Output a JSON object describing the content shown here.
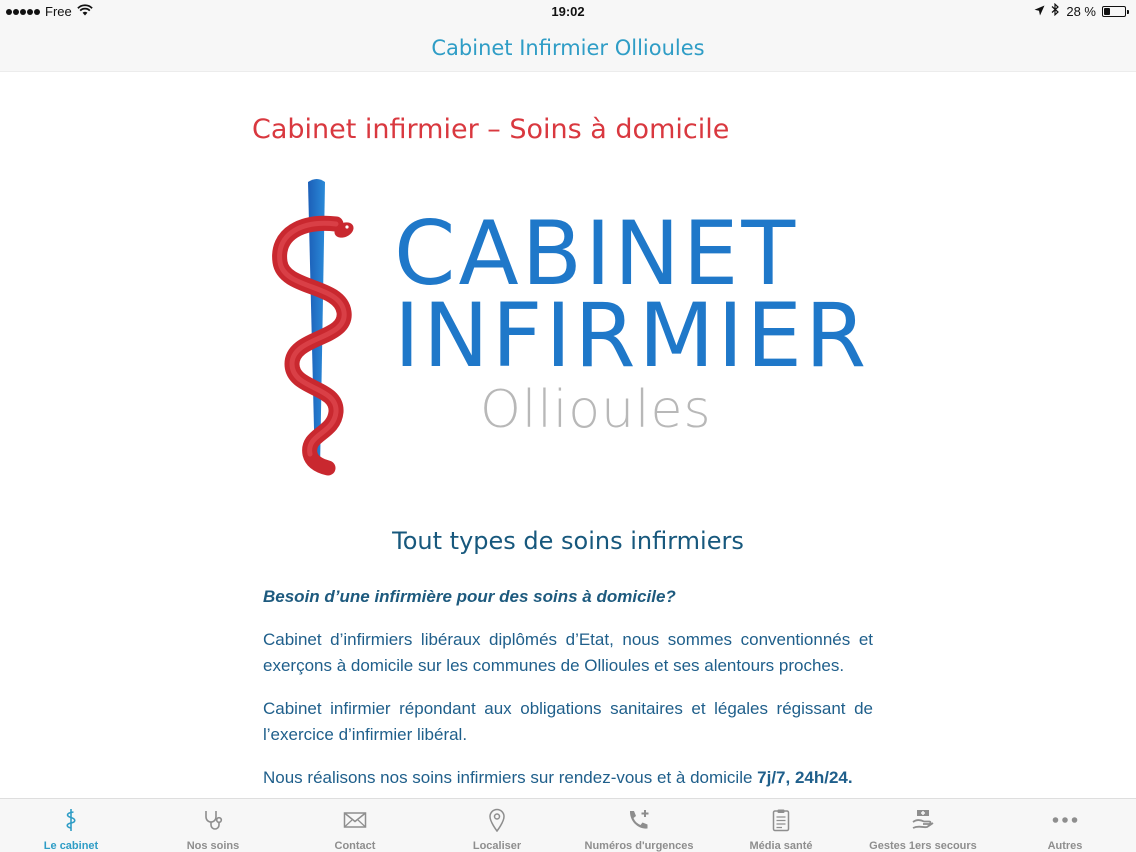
{
  "status": {
    "carrier": "Free",
    "time": "19:02",
    "battery": "28 %",
    "battery_level": 0.28
  },
  "nav": {
    "title": "Cabinet Infirmier Ollioules"
  },
  "page": {
    "heading": "Cabinet infirmier – Soins à domicile",
    "logo": {
      "word1": "CABINET",
      "word2": "INFIRMIER",
      "word3": "Ollioules",
      "colors": {
        "snake": "#d9383f",
        "staff": "#1f78c9",
        "wordmark": "#1f78c9",
        "subtitle": "#b8b8b8"
      }
    },
    "section_title": "Tout types de soins infirmiers",
    "lead": "Besoin d’une infirmière pour des soins à domicile?",
    "paragraphs": [
      "Cabinet d’infirmiers libéraux diplômés d’Etat, nous sommes conventionnés et exerçons à domicile sur les communes de Ollioules et ses alentours proches.",
      "Cabinet infirmier répondant aux obligations sanitaires et légales régissant de l’exercice d’infirmier libéral."
    ],
    "last_paragraph": {
      "text": "Nous réalisons nos soins infirmiers sur rendez-vous et à domicile ",
      "emphasis": "7j/7, 24h/24."
    }
  },
  "tabs": [
    {
      "label": "Le cabinet",
      "icon": "caduceus-icon",
      "active": true
    },
    {
      "label": "Nos soins",
      "icon": "stethoscope-icon",
      "active": false
    },
    {
      "label": "Contact",
      "icon": "envelope-icon",
      "active": false
    },
    {
      "label": "Localiser",
      "icon": "map-pin-icon",
      "active": false
    },
    {
      "label": "Numéros d'urgences",
      "icon": "phone-plus-icon",
      "active": false
    },
    {
      "label": "Média santé",
      "icon": "clipboard-icon",
      "active": false
    },
    {
      "label": "Gestes 1ers secours",
      "icon": "first-aid-hand-icon",
      "active": false
    },
    {
      "label": "Autres",
      "icon": "more-dots-icon",
      "active": false
    }
  ],
  "colors": {
    "accent": "#2f9dc6",
    "heading_red": "#d9383f",
    "text_blue": "#1f5f8b",
    "tab_inactive": "#8e8e8e"
  }
}
